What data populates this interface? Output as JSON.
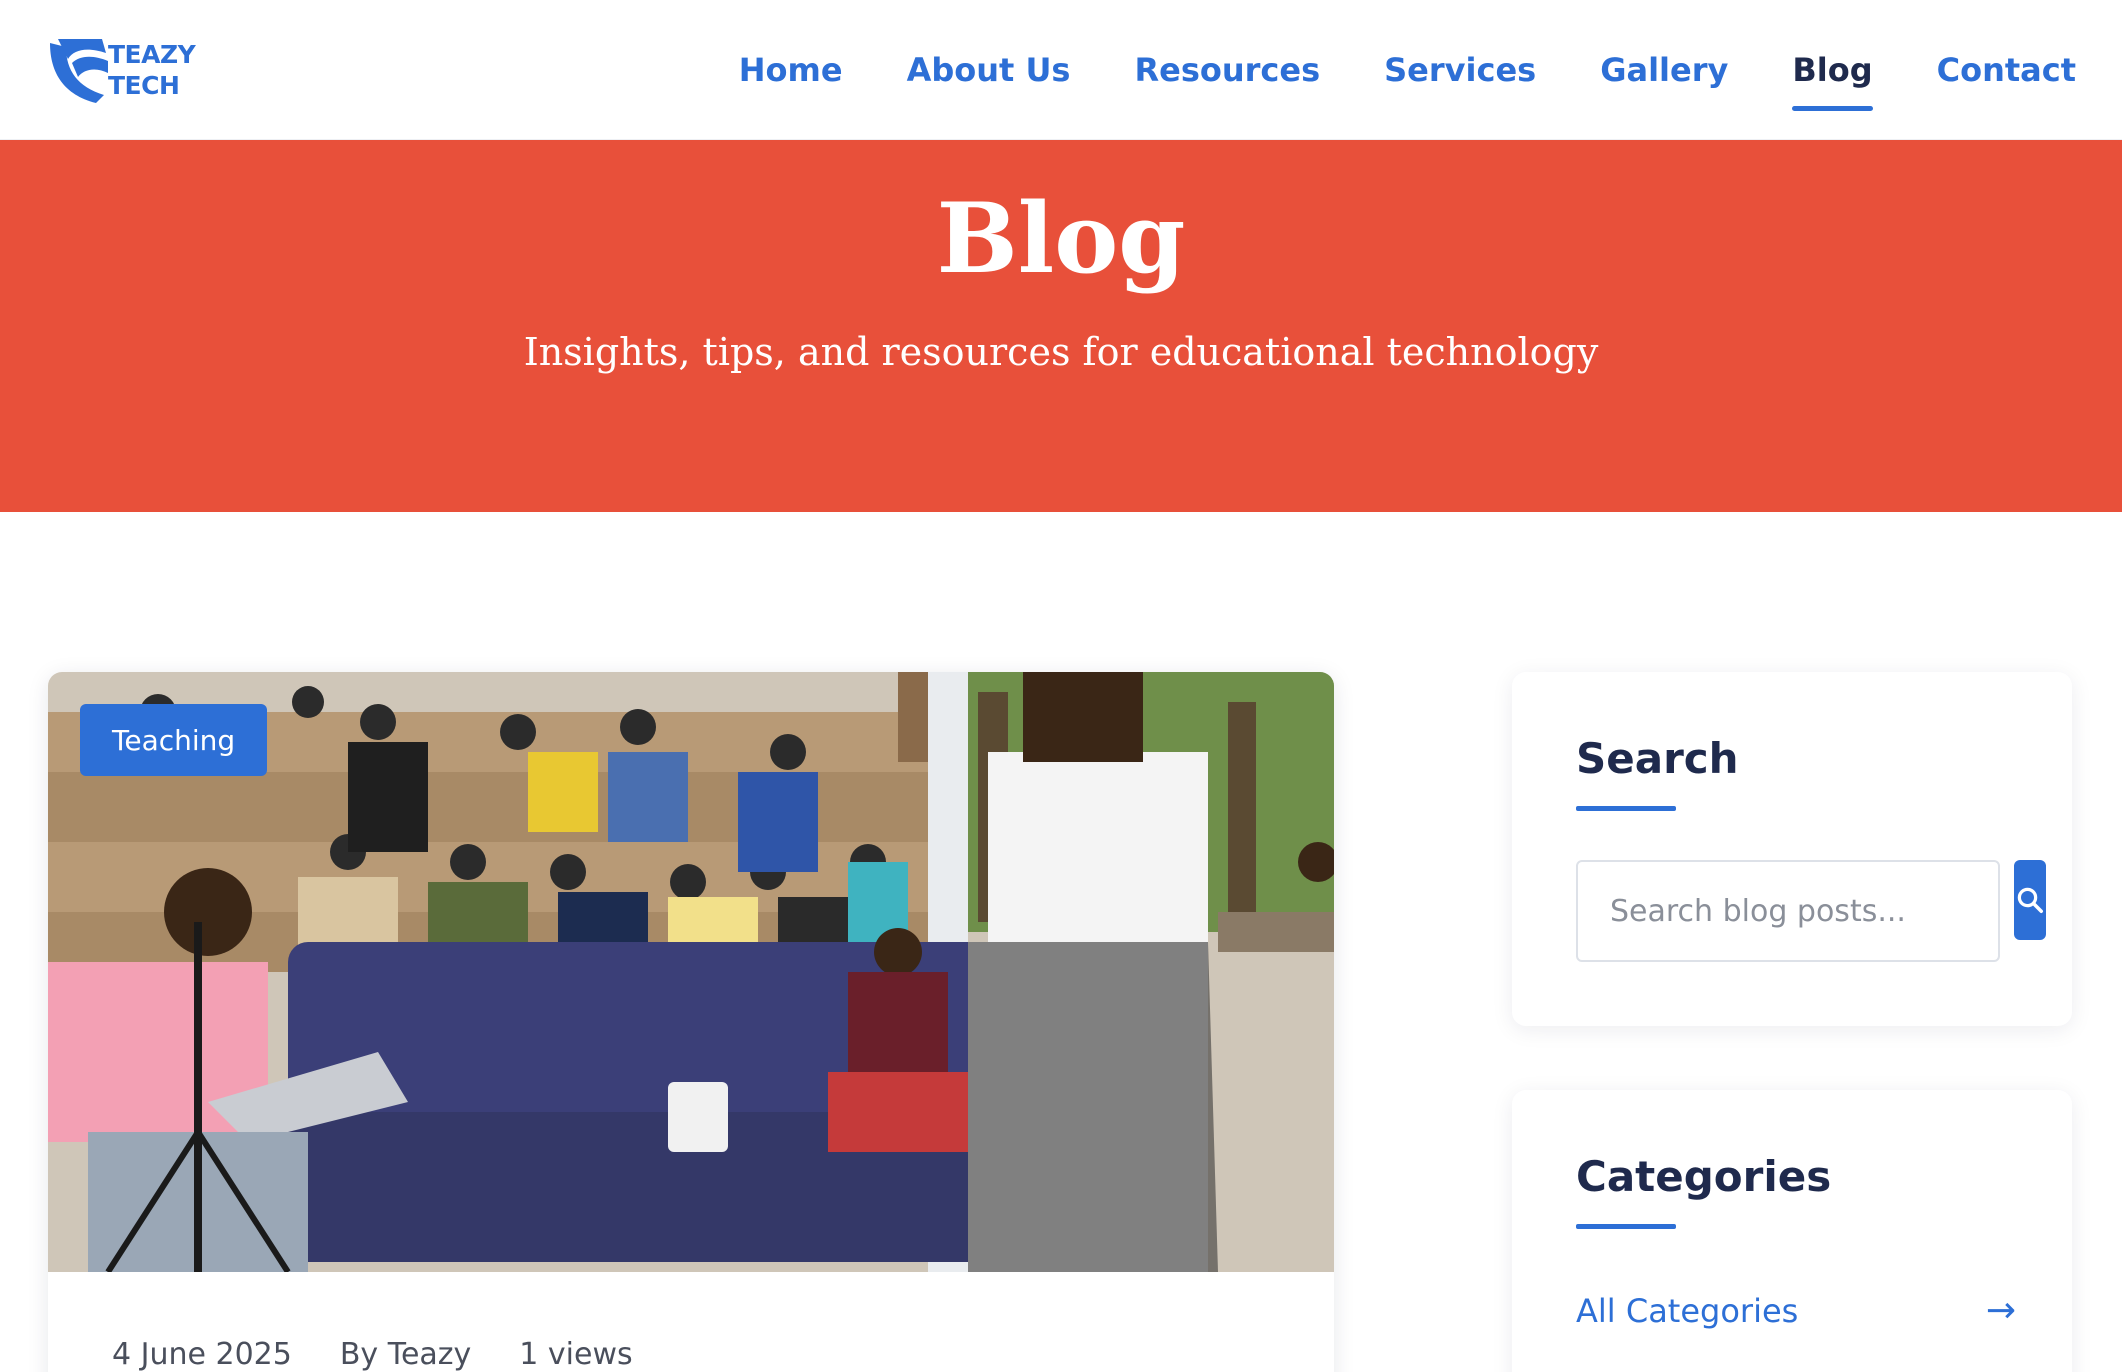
{
  "logo": {
    "line1": "TEAZY",
    "line2": "TECH",
    "icon": "teazy-logo-icon"
  },
  "nav": {
    "items": [
      {
        "label": "Home"
      },
      {
        "label": "About Us"
      },
      {
        "label": "Resources"
      },
      {
        "label": "Services"
      },
      {
        "label": "Gallery"
      },
      {
        "label": "Blog",
        "active": true
      },
      {
        "label": "Contact"
      }
    ]
  },
  "hero": {
    "title": "Blog",
    "subtitle": "Insights, tips, and resources for educational technology"
  },
  "post": {
    "category": "Teaching",
    "date": "4 June 2025",
    "author": "By Teazy",
    "views": "1 views"
  },
  "sidebar": {
    "search": {
      "title": "Search",
      "placeholder": "Search blog posts...",
      "button_icon": "search-icon"
    },
    "categories": {
      "title": "Categories",
      "items": [
        {
          "label": "All Categories",
          "arrow": "→"
        }
      ]
    }
  },
  "colors": {
    "brand_blue": "#2d6fd6",
    "hero_red": "#e8503a",
    "navy": "#1f2a4d"
  }
}
